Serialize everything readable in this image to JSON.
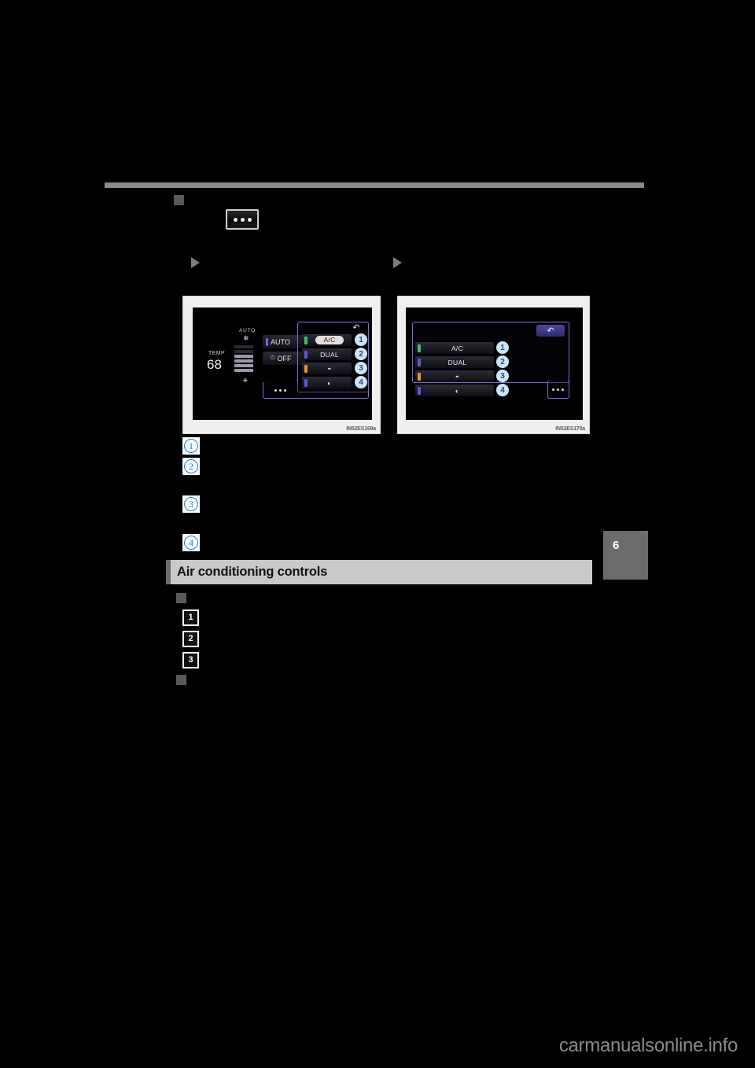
{
  "page": {
    "chapter_number": "6",
    "section_heading": "Air conditioning controls",
    "watermark": "carmanualsonline.info"
  },
  "top_controls": {
    "menu_button_icon": "ellipsis-icon",
    "menu_button_label": "•••"
  },
  "figures": [
    {
      "id": "left",
      "code": "IN52ES169a",
      "screen": {
        "temp_label": "TEMP",
        "temp_value": "68",
        "fan_auto_label": "AUTO",
        "fan_top_icon": "fan-icon",
        "fan_bottom_icon": "fan-speed-icon",
        "fan_levels_total": 6,
        "fan_levels_on": 4,
        "mid_buttons": [
          {
            "label": "AUTO",
            "chip_color": "#6a6ad8",
            "icon": ""
          },
          {
            "label": "OFF",
            "chip_color": "#6a6ad8",
            "icon": "power-icon"
          }
        ],
        "list_buttons": [
          {
            "label": "A/C",
            "chip_color": "#3fbf6f",
            "highlighted": true,
            "icon": ""
          },
          {
            "label": "DUAL",
            "chip_color": "#5a5ad6",
            "highlighted": false,
            "icon": ""
          },
          {
            "label": "",
            "chip_color": "#e0952f",
            "highlighted": false,
            "icon": "front-defogger-icon"
          },
          {
            "label": "",
            "chip_color": "#5a5ad6",
            "highlighted": false,
            "icon": "rear-defogger-icon"
          }
        ],
        "back_button_icon": "back-arrow-icon",
        "more_button_icon": "ellipsis-icon"
      },
      "callouts": [
        "1",
        "2",
        "3",
        "4"
      ]
    },
    {
      "id": "right",
      "code": "IN52ES170a",
      "screen": {
        "list_buttons": [
          {
            "label": "A/C",
            "chip_color": "#3fbf6f",
            "highlighted": false,
            "icon": ""
          },
          {
            "label": "DUAL",
            "chip_color": "#5a5ad6",
            "highlighted": false,
            "icon": ""
          },
          {
            "label": "",
            "chip_color": "#e0952f",
            "highlighted": false,
            "icon": "front-defogger-icon"
          },
          {
            "label": "",
            "chip_color": "#5a5ad6",
            "highlighted": false,
            "icon": "rear-defogger-icon"
          }
        ],
        "back_button_icon": "back-arrow-icon",
        "more_button_icon": "ellipsis-icon"
      },
      "callouts": [
        "1",
        "2",
        "3",
        "4"
      ]
    }
  ],
  "body_callouts": {
    "circled": [
      "1",
      "2",
      "3",
      "4"
    ],
    "squared": [
      "1",
      "2",
      "3"
    ]
  },
  "colors": {
    "accent_blue": "#1a7fd4",
    "rule_gray": "#8a8a8a",
    "heading_bg": "#c9c9c9",
    "heading_bar_tab": "#6e6e6e",
    "chapter_tab": "#6b6b6b",
    "panel_outline_purple": "#7b6fd4",
    "page_bg": "#000000"
  }
}
